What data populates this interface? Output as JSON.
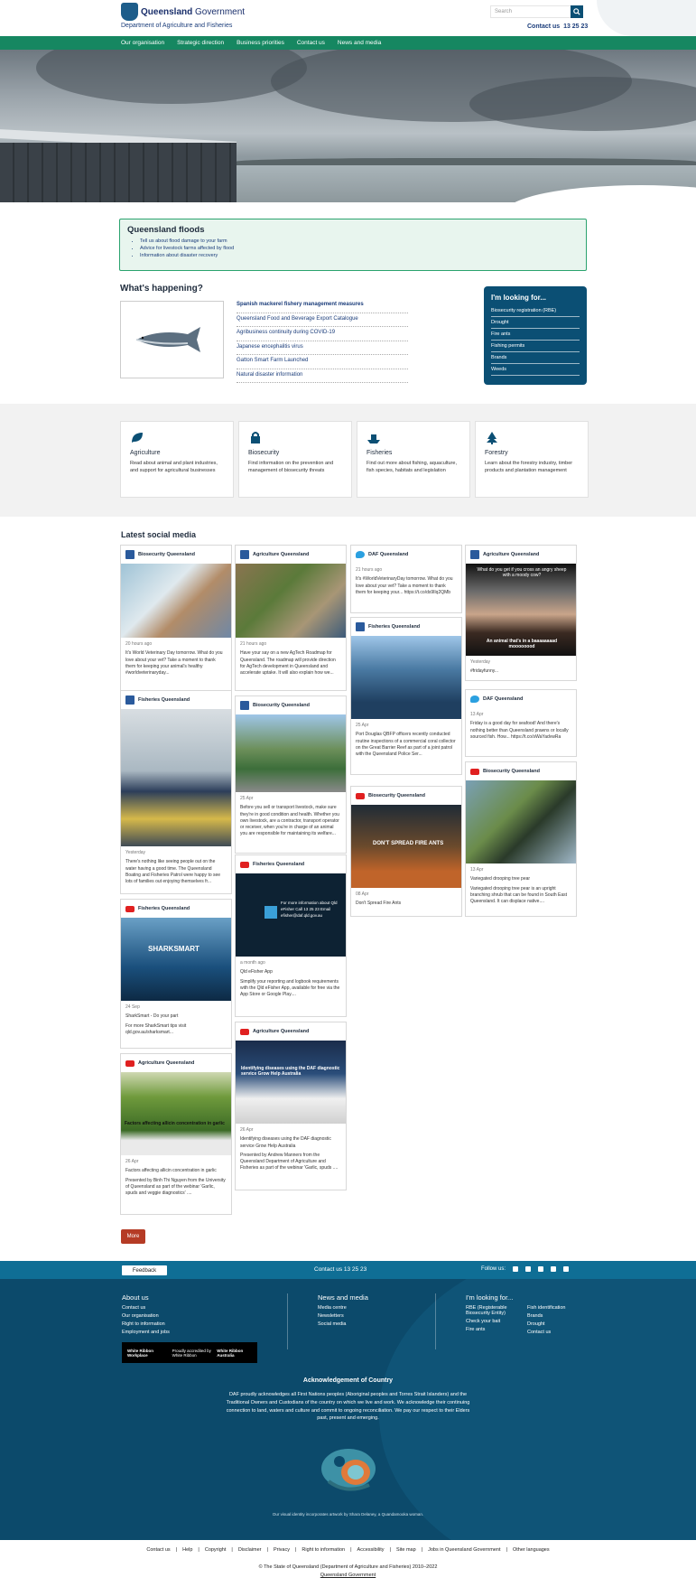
{
  "header": {
    "gov_bold": "Queensland",
    "gov_rest": " Government",
    "department": "Department of Agriculture and Fisheries",
    "search_placeholder": "Search",
    "contact_label": "Contact us",
    "contact_phone": "13 25 23"
  },
  "nav": [
    "Our organisation",
    "Strategic direction",
    "Business priorities",
    "Contact us",
    "News and media"
  ],
  "alert": {
    "title": "Queensland floods",
    "items": [
      "Tell us about flood damage to your farm",
      "Advice for livestock farms affected by flood",
      "Information about disaster recovery"
    ]
  },
  "whats_happening": {
    "title": "What's happening?",
    "items": [
      "Spanish mackerel fishery management measures",
      "Queensland Food and Beverage Export Catalogue",
      "Agribusiness continuity during COVID-19",
      "Japanese encephalitis virus",
      "Gatton Smart Farm Launched",
      "Natural disaster information"
    ]
  },
  "looking_for": {
    "title": "I'm looking for...",
    "items": [
      "Biosecurity registration (RBE)",
      "Drought",
      "Fire ants",
      "Fishing permits",
      "Brands",
      "Weeds"
    ]
  },
  "categories": [
    {
      "icon": "leaf-icon",
      "title": "Agriculture",
      "text": "Read about animal and plant industries, and support for agricultural businesses"
    },
    {
      "icon": "lock-icon",
      "title": "Biosecurity",
      "text": "Find information on the prevention and management of biosecurity threats"
    },
    {
      "icon": "boat-icon",
      "title": "Fisheries",
      "text": "Find out more about fishing, aquaculture, fish species, habitats and legislation"
    },
    {
      "icon": "tree-icon",
      "title": "Forestry",
      "text": "Learn about the forestry industry, timber products and plantation management"
    }
  ],
  "social": {
    "title": "Latest social media",
    "more_label": "More",
    "posts": [
      {
        "net": "fb",
        "account": "Biosecurity Queensland",
        "date": "20 hours ago",
        "text": "It's World Veterinary Day tomorrow. What do you love about your vet? Take a moment to thank them for keeping your animal's healthy #worldveterinaryday...",
        "img": "cat"
      },
      {
        "net": "fb",
        "account": "Fisheries Queensland",
        "date": "Yesterday",
        "text": "There's nothing like seeing people out on the water having a good time. The Queensland Boating and Fisheries Patrol were happy to see lots of families out enjoying themselves fr...",
        "img": "people"
      },
      {
        "net": "yt",
        "account": "Fisheries Queensland",
        "date": "24 Sep",
        "title": "SharkSmart - Do your part",
        "text": "For more SharkSmart tips visit qld.gov.au/sharksmart...",
        "img": "shark"
      },
      {
        "net": "yt",
        "account": "Agriculture Queensland",
        "date": "26 Apr",
        "title": "Factors affecting allicin concentration in garlic",
        "text": "Presented by Binh Thi Nguyen from the University of Queensland as part of the webinar 'Garlic, spuds and veggie diagnostics' ....",
        "img": "garlic"
      },
      {
        "net": "fb",
        "account": "Agriculture Queensland",
        "date": "21 hours ago",
        "text": "Have your say on a new AgTech Roadmap for Queensland. The roadmap will provide direction for AgTech development in Queensland and accelerate uptake. It will also explain how we...",
        "img": "crop"
      },
      {
        "net": "fb",
        "account": "Biosecurity Queensland",
        "date": "25 Apr",
        "text": "Before you sell or transport livestock, make sure they're in good condition and health. Whether you own livestock, are a contractor, transport operator or receiver, when you're in charge of an animal you are responsible for maintaining its welfare...",
        "img": "truck"
      },
      {
        "net": "yt",
        "account": "Fisheries Queensland",
        "date": "a month ago",
        "title": "Qld eFisher App",
        "text": "Simplify your reporting and logbook requirements with the Qld eFisher App, available for free via the App Store or Google Play....",
        "img": "efisher"
      },
      {
        "net": "yt",
        "account": "Agriculture Queensland",
        "date": "26 Apr",
        "text": "Identifying diseases using the DAF diagnostic service Grow Help Australia",
        "text2": "Presented by Andrew Manners from the Queensland Department of Agriculture and Fisheries as part of the webinar 'Garlic, spuds ....",
        "img": "diag"
      },
      {
        "net": "tw",
        "account": "DAF Queensland",
        "date": "21 hours ago",
        "text": "It's #WorldVeterinaryDay tomorrow. What do you love about your vet? Take a moment to thank them for keeping your... https://t.co/ds9Ilq2QMb"
      },
      {
        "net": "fb",
        "account": "Fisheries Queensland",
        "date": "25 Apr",
        "text": "Port Douglas QBFP officers recently conducted routine inspections of a commercial coral collector on the Great Barrier Reef as part of a joint patrol with the Queensland Police Ser...",
        "img": "boat"
      },
      {
        "net": "yt",
        "account": "Biosecurity Queensland",
        "date": "08 Apr",
        "text": "Don't Spread Fire Ants",
        "img": "fireants"
      },
      {
        "net": "fb",
        "account": "Agriculture Queensland",
        "date": "Yesterday",
        "text": "#fridayfunny...",
        "img": "sheep"
      },
      {
        "net": "tw",
        "account": "DAF Queensland",
        "date": "13 Apr",
        "text": "Friday is a good day for seafood! And there's nothing better than Queensland prawns or locally sourced fish. How... https://t.co/sWaYadvwRa"
      },
      {
        "net": "yt",
        "account": "Biosecurity Queensland",
        "date": "13 Apr",
        "title": "Variegated drooping tree pear",
        "text": "Variegated drooping tree pear is an upright branching shrub that can be found in South East Queensland. It can displace native....",
        "img": "cactus"
      }
    ],
    "overlay": {
      "shark": "SHARKSMART",
      "garlic": "Factors affecting allicin concentration in garlic",
      "efisher": "For more information about Qld eFisher Call 13 25 23 Email efisher@daf.qld.gov.au",
      "diag": "Identifying diseases using the DAF diagnostic service Grow Help Australia",
      "fireants": "DON'T SPREAD FIRE ANTS",
      "sheep_top": "What do you get if you cross an angry sheep with a moody cow?",
      "sheep_bottom": "An animal that's in a baaaaaaaad moooooood"
    }
  },
  "footer": {
    "feedback": "Feedback",
    "contact": "Contact us 13 25 23",
    "follow": "Follow us:",
    "about": {
      "title": "About us",
      "links": [
        "Contact us",
        "Our organisation",
        "Right to information",
        "Employment and jobs"
      ]
    },
    "news": {
      "title": "News and media",
      "links": [
        "Media centre",
        "Newsletters",
        "Social media"
      ]
    },
    "looking": {
      "title": "I'm looking for...",
      "col1": [
        "RBE (Registerable Biosecurity Entity)",
        "Check your bait",
        "Fire ants"
      ],
      "col2": [
        "Fish identification",
        "Brands",
        "Drought",
        "Contact us"
      ]
    },
    "white_ribbon": "White Ribbon Workplace",
    "white_ribbon2": "Proudly accredited by White Ribbon",
    "white_ribbon3": "White Ribbon Australia",
    "ack_title": "Acknowledgement of Country",
    "ack_text": "DAF proudly acknowledges all First Nations peoples (Aboriginal peoples and Torres Strait Islanders) and the Traditional Owners and Custodians of the country on which we live and work. We acknowledge their continuing connection to land, waters and culture and commit to ongoing reconciliation. We pay our respect to their Elders past, present and emerging.",
    "art_caption": "Our visual identity incorporates artwork by Shara Delaney, a Quandamooka woman.",
    "legal": [
      "Contact us",
      "Help",
      "Copyright",
      "Disclaimer",
      "Privacy",
      "Right to information",
      "Accessibility",
      "Site map",
      "Jobs in Queensland Government",
      "Other languages"
    ],
    "copyright": "© The State of Queensland (Department of Agriculture and Fisheries) 2010–2022",
    "qg": "Queensland Government"
  }
}
